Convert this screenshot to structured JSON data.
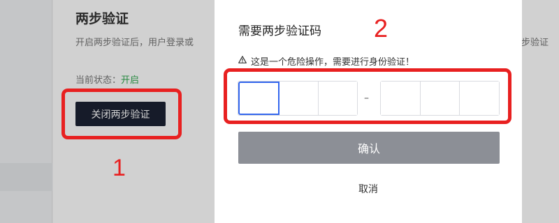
{
  "background": {
    "section_title": "两步验证",
    "description": "开启两步验证后，用户登录或",
    "description_tail": "步验证",
    "status_label": "当前状态：",
    "status_value": "开启",
    "disable_button": "关闭两步验证"
  },
  "modal": {
    "title": "需要两步验证码",
    "warning": "这是一个危险操作，需要进行身份验证！",
    "code_separator": "–",
    "confirm_label": "确认",
    "cancel_label": "取消"
  },
  "annotations": {
    "step1": "1",
    "step2": "2"
  },
  "colors": {
    "annotation": "#e82020",
    "status_on": "#2fa84f",
    "dark_button": "#1b2233",
    "active_input_border": "#3366ee",
    "disabled_button": "#8c8f96"
  },
  "icons": {
    "warning": "warning-triangle-icon"
  }
}
